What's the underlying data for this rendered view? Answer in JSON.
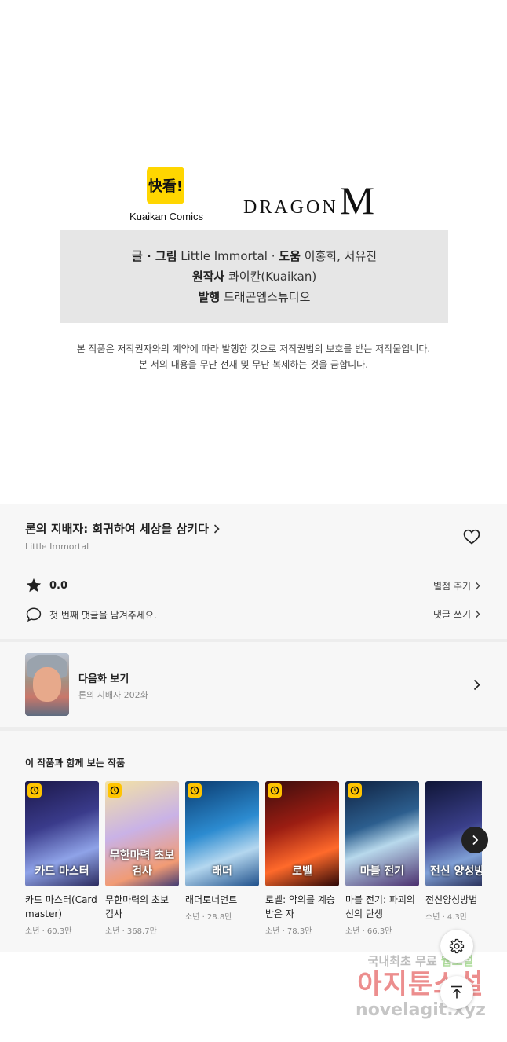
{
  "logos": {
    "kuaikan_mark": "快看!",
    "kuaikan_name": "Kuaikan Comics",
    "dragon_word": "DRAGON",
    "dragon_m": "M"
  },
  "credits": {
    "row1_label1": "글 · 그림",
    "row1_value1": "Little Immortal",
    "row1_sep": "·",
    "row1_label2": "도움",
    "row1_value2": "이홍희, 서유진",
    "row2_label": "원작사",
    "row2_value": "콰이칸(Kuaikan)",
    "row3_label": "발행",
    "row3_value": "드래곤엠스튜디오"
  },
  "notice": {
    "line1": "본 작품은 저작권자와의 계약에 따라 발행한 것으로 저작권법의 보호를 받는 저작물입니다.",
    "line2": "본 서의 내용을 무단 전재 및 무단 복제하는 것을 금합니다."
  },
  "work": {
    "title": "론의 지배자: 회귀하여 세상을 삼키다",
    "author": "Little Immortal",
    "rating": "0.0",
    "rate_link": "별점 주기",
    "comment_prompt": "첫 번째 댓글을 남겨주세요.",
    "comment_link": "댓글 쓰기"
  },
  "next": {
    "label": "다음화 보기",
    "subtitle": "론의 지배자 202화"
  },
  "recommend": {
    "heading": "이 작품과 함께 보는 작품",
    "items": [
      {
        "name": "카드 마스터(Card master)",
        "meta": "소년 · 60.3만",
        "cover_text": "카드 마스터"
      },
      {
        "name": "무한마력의 초보 검사",
        "meta": "소년 · 368.7만",
        "cover_text": "무한마력 초보검사"
      },
      {
        "name": "래더토너먼트",
        "meta": "소년 · 28.8만",
        "cover_text": "래더"
      },
      {
        "name": "로벨: 악의를 계승받은 자",
        "meta": "소년 · 78.3만",
        "cover_text": "로벨"
      },
      {
        "name": "마블 전기: 파괴의 신의 탄생",
        "meta": "소년 · 66.3만",
        "cover_text": "마블 전기"
      },
      {
        "name": "전신양성방법",
        "meta": "소년 · 4.3만",
        "cover_text": "전신 양성방법"
      }
    ]
  },
  "watermark": {
    "line1a": "국내최초 무료",
    "line1b": "웹소설",
    "line2": "아지툰소설",
    "line3": "novelagit.xyz"
  },
  "icons": {
    "heart": "heart-icon",
    "star": "star-icon",
    "comment": "comment-icon",
    "settings": "gear-icon",
    "top": "arrow-up-icon"
  }
}
